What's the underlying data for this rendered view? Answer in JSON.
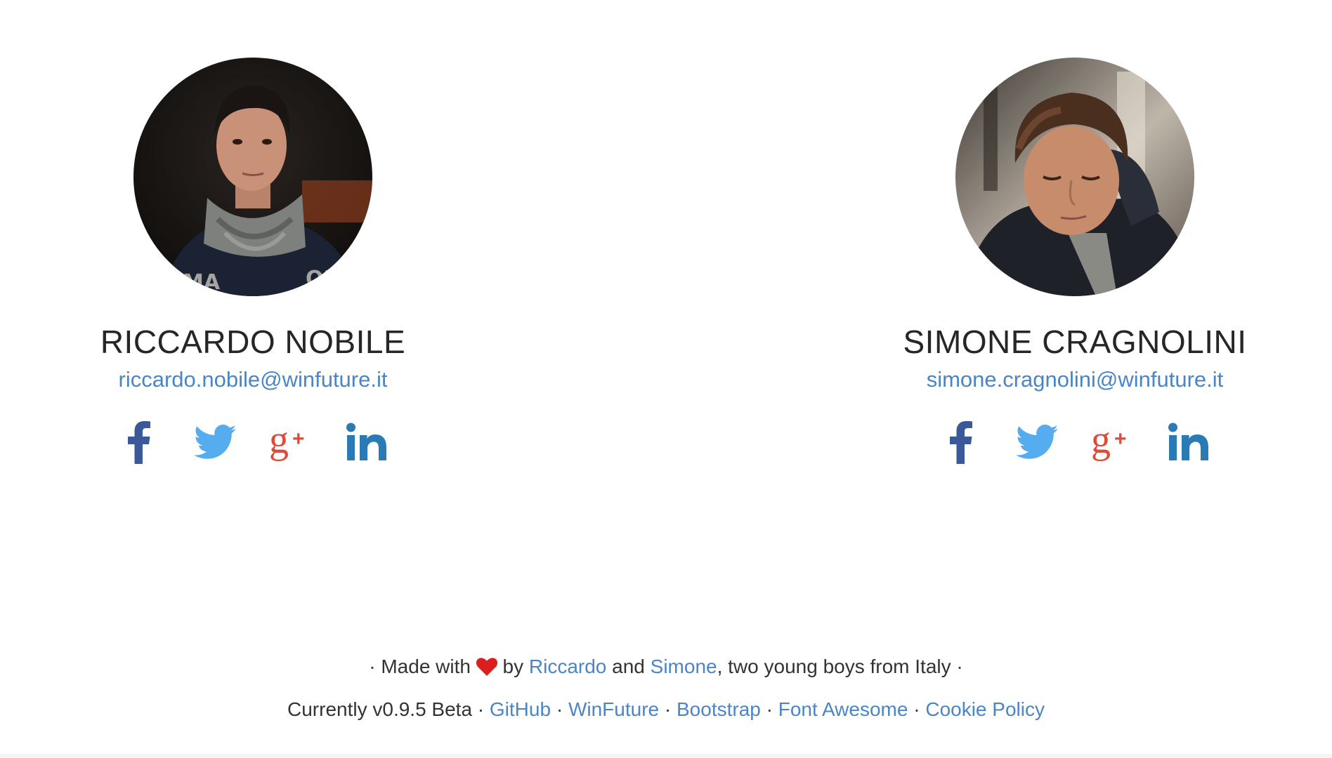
{
  "people": [
    {
      "name": "RICCARDO NOBILE",
      "email": "riccardo.nobile@winfuture.it",
      "avatar_icon": "person-photo",
      "socials": [
        {
          "icon": "facebook-icon",
          "color": "#3b5998"
        },
        {
          "icon": "twitter-icon",
          "color": "#55acee"
        },
        {
          "icon": "google-plus-icon",
          "color": "#dd4b39"
        },
        {
          "icon": "linkedin-icon",
          "color": "#2a7ab6"
        }
      ]
    },
    {
      "name": "SIMONE CRAGNOLINI",
      "email": "simone.cragnolini@winfuture.it",
      "avatar_icon": "person-photo",
      "socials": [
        {
          "icon": "facebook-icon",
          "color": "#3b5998"
        },
        {
          "icon": "twitter-icon",
          "color": "#55acee"
        },
        {
          "icon": "google-plus-icon",
          "color": "#dd4b39"
        },
        {
          "icon": "linkedin-icon",
          "color": "#2a7ab6"
        }
      ]
    }
  ],
  "footer": {
    "line1": {
      "prefix": "· Made with",
      "heart_icon": "heart-icon",
      "by": "by",
      "link1": "Riccardo",
      "and": "and",
      "link2": "Simone",
      "suffix": ", two young boys from Italy ·"
    },
    "line2": {
      "version": "Currently v0.9.5 Beta ·",
      "links": [
        "GitHub",
        "WinFuture",
        "Bootstrap",
        "Font Awesome",
        "Cookie Policy"
      ],
      "separator": "·"
    }
  },
  "colors": {
    "link": "#4a86c5",
    "text": "#262626",
    "heart": "#d9201f"
  }
}
